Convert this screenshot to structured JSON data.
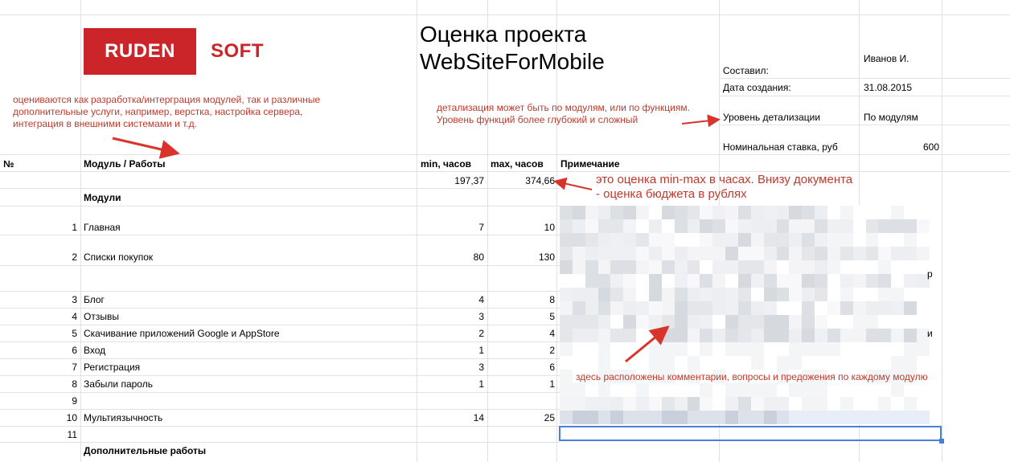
{
  "logo": {
    "part1": "RUDEN",
    "part2": "SOFT"
  },
  "title": {
    "line1": "Оценка проекта",
    "line2": "WebSiteForMobile"
  },
  "meta": {
    "composed_label": "Составил:",
    "composed_value": "Иванов И.",
    "date_label": "Дата создания:",
    "date_value": "31.08.2015",
    "detail_label": "Уровень детализации",
    "detail_value": "По модулям",
    "rate_label": "Номинальная ставка, руб",
    "rate_value": "600"
  },
  "annotations": {
    "left_note": [
      "оцениваются как разработка/интерграция модулей, так и различные",
      "дополнительные услуги, например, верстка, настройка сервера,",
      "интеграция в внешними системами и т.д."
    ],
    "center_note": [
      "детализация может быть по модулям, или по функциям.",
      "Уровень функций более глубокий и сложный"
    ],
    "minmax_note": [
      "это оценка min-max в часах. Внизу документа",
      "- оценка бюджета в рублях"
    ],
    "comments_note": "здесь расположены комментарии, вопросы и предожения по каждому модулю"
  },
  "table": {
    "headers": {
      "no": "№",
      "module": "Модуль / Работы",
      "min": "min, часов",
      "max": "max, часов",
      "note": "Примечание"
    },
    "totals": {
      "min": "197,37",
      "max": "374,66"
    },
    "section_modules": "Модули",
    "rows": [
      {
        "no": "1",
        "name": "Главная",
        "min": "7",
        "max": "10"
      },
      {
        "no": "2",
        "name": "Списки покупок",
        "min": "80",
        "max": "130"
      },
      {
        "no": "3",
        "name": "Блог",
        "min": "4",
        "max": "8"
      },
      {
        "no": "4",
        "name": "Отзывы",
        "min": "3",
        "max": "5"
      },
      {
        "no": "5",
        "name": "Скачивание приложений Google и AppStore",
        "min": "2",
        "max": "4"
      },
      {
        "no": "6",
        "name": "Вход",
        "min": "1",
        "max": "2"
      },
      {
        "no": "7",
        "name": "Регистрация",
        "min": "3",
        "max": "6"
      },
      {
        "no": "8",
        "name": "Забыли пароль",
        "min": "1",
        "max": "1"
      },
      {
        "no": "9",
        "name": "",
        "min": "",
        "max": ""
      },
      {
        "no": "10",
        "name": "Мультиязычность",
        "min": "14",
        "max": "25"
      },
      {
        "no": "11",
        "name": "",
        "min": "",
        "max": ""
      }
    ],
    "section_additional": "Дополнительные работы",
    "partial_chars": {
      "r": "р",
      "i": "и"
    }
  },
  "colors": {
    "accent": "#cc2529",
    "annotation": "#c0392b",
    "selection": "#4a7fd8"
  }
}
